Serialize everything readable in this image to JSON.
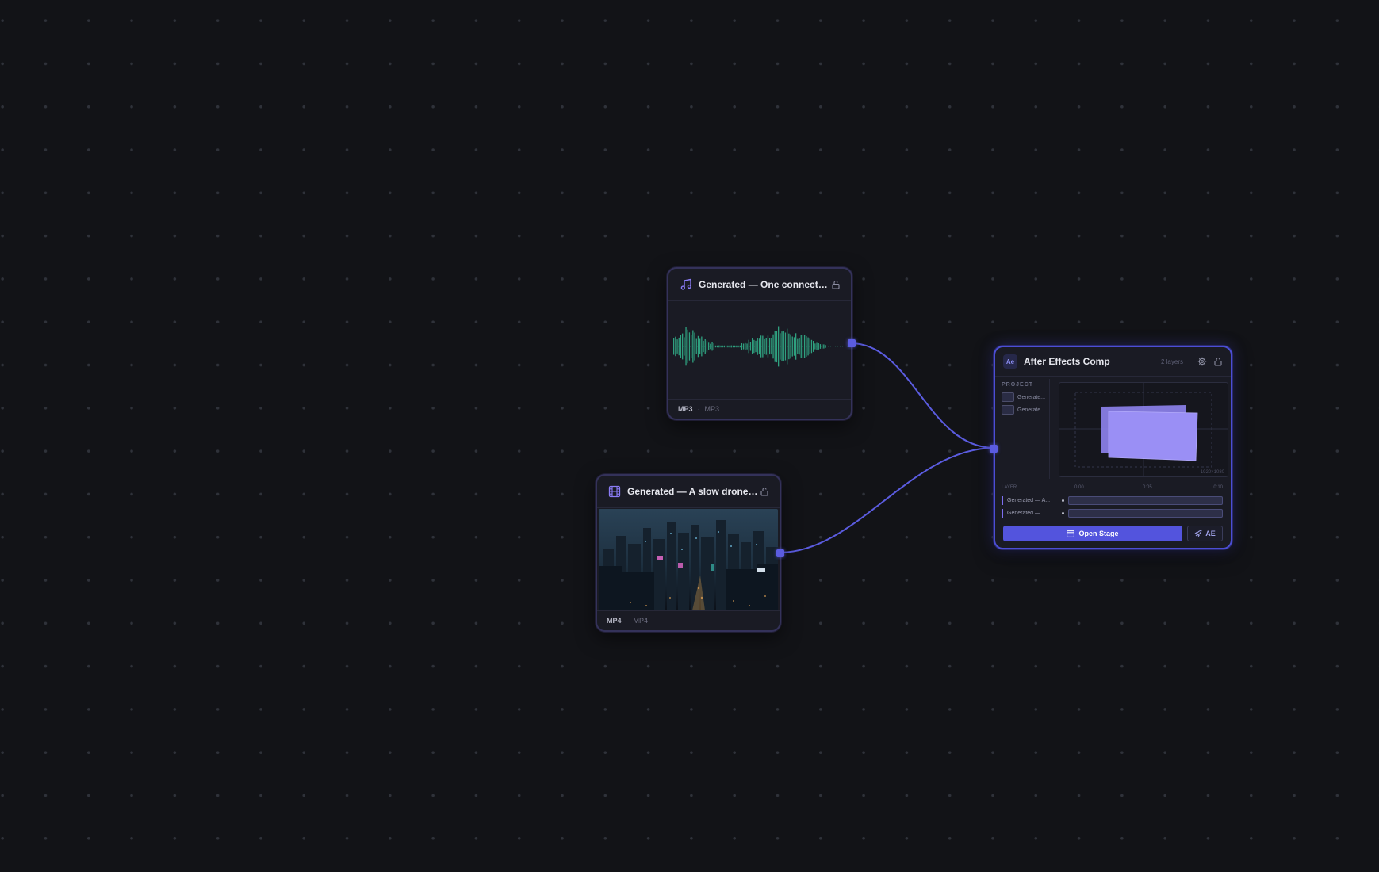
{
  "canvas": {
    "background": "#121317",
    "dot_color": "#2f323a"
  },
  "edges_color": "#5b5ce0",
  "audio_node": {
    "title": "Generated — One connection...",
    "icon": "music-note-icon",
    "format": "MP3",
    "format_secondary": "MP3",
    "waveform_color": "#2fa07f"
  },
  "video_node": {
    "title": "Generated — A slow drone s...",
    "icon": "film-icon",
    "format": "MP4",
    "format_secondary": "MP4"
  },
  "ae_node": {
    "badge": "Ae",
    "title": "After Effects Comp",
    "layers_count": "2 layers",
    "project_label": "PROJECT",
    "project_items": [
      "Generate...",
      "Generate..."
    ],
    "resolution": "1920×1080",
    "timeline": {
      "header": "LAYER",
      "ticks": [
        "0:00",
        "0:05",
        "0:10"
      ],
      "tracks": [
        "Generated — A...",
        "Generated — ..."
      ]
    },
    "open_stage_label": "Open Stage",
    "export_label": "AE",
    "accent": "#5354dd"
  }
}
